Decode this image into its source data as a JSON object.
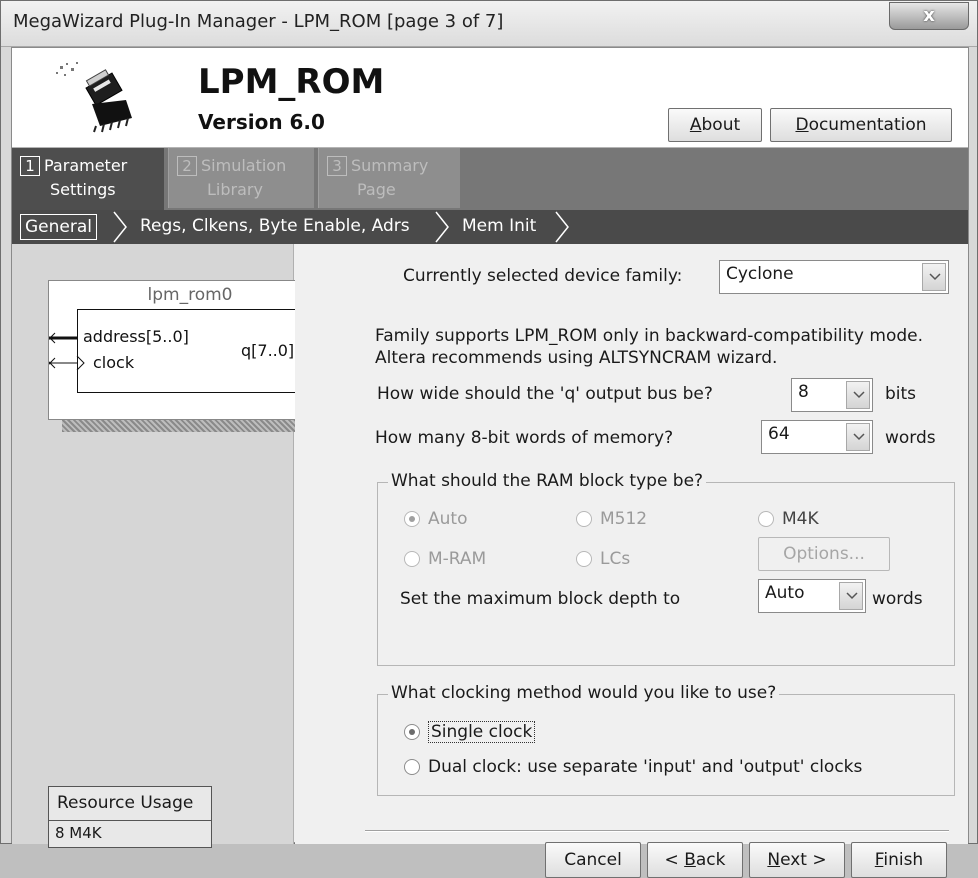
{
  "window": {
    "title": "MegaWizard Plug-In Manager - LPM_ROM [page 3 of 7]",
    "close_label": "x"
  },
  "header": {
    "component": "LPM_ROM",
    "version": "Version 6.0",
    "about_label": "About",
    "documentation_label": "Documentation",
    "icon": "chip-wizard-icon"
  },
  "tabs": [
    {
      "num": "1",
      "line1": "Parameter",
      "line2": "Settings",
      "active": true
    },
    {
      "num": "2",
      "line1": "Simulation",
      "line2": "Library",
      "active": false
    },
    {
      "num": "3",
      "line1": "Summary",
      "line2": "Page",
      "active": false
    }
  ],
  "breadcrumbs": [
    "General",
    "Regs, Clkens, Byte Enable, Adrs",
    "Mem Init"
  ],
  "symbol": {
    "name": "lpm_rom0",
    "in_address": "address[5..0]",
    "in_clock": "clock",
    "out_q": "q[7..0]"
  },
  "resource": {
    "header": "Resource Usage",
    "value": "8 M4K"
  },
  "form": {
    "device_family_label": "Currently selected device family:",
    "device_family_value": "Cyclone",
    "compat_line1": "Family supports LPM_ROM only in backward-compatibility mode.",
    "compat_line2": "Altera recommends using ALTSYNCRAM wizard.",
    "width_label": "How wide should the 'q' output bus be?",
    "width_value": "8",
    "width_unit": "bits",
    "words_label": "How many 8-bit words of memory?",
    "words_value": "64",
    "words_unit": "words",
    "ram_group_title": "What should the RAM block type be?",
    "ram_auto": "Auto",
    "ram_m512": "M512",
    "ram_m4k": "M4K",
    "ram_mram": "M-RAM",
    "ram_lcs": "LCs",
    "options_label": "Options...",
    "max_depth_label": "Set the maximum block depth to",
    "max_depth_value": "Auto",
    "max_depth_unit": "words",
    "clock_group_title": "What clocking method would you like to use?",
    "single_clock": "Single clock",
    "dual_clock": "Dual clock: use separate 'input' and 'output' clocks"
  },
  "footer": {
    "cancel": "Cancel",
    "back": "< Back",
    "next": "Next >",
    "finish": "Finish"
  }
}
